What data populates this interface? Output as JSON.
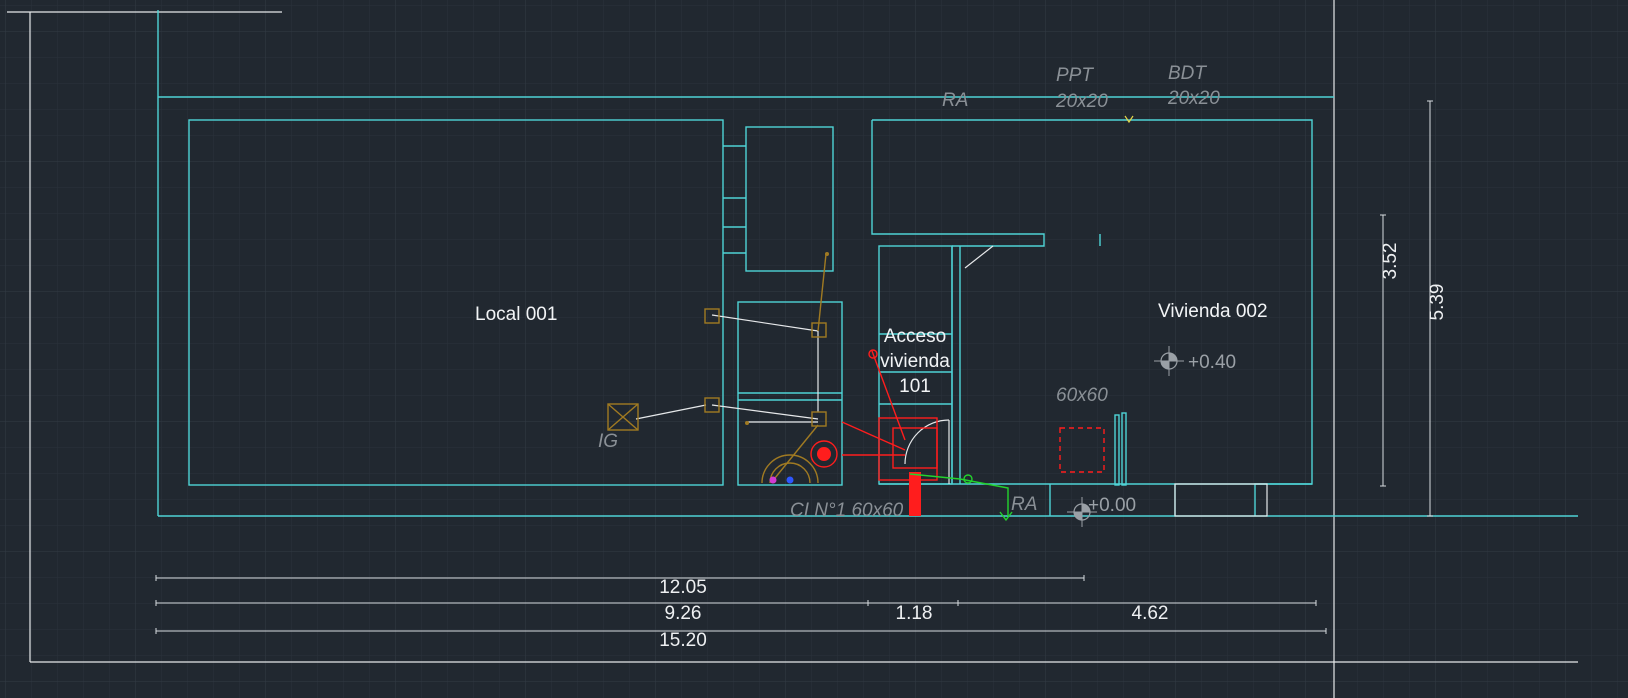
{
  "drawing": {
    "rooms": {
      "local": "Local 001",
      "vivienda": "Vivienda 002",
      "acceso_l1": "Acceso",
      "acceso_l2": "vivienda",
      "acceso_l3": "101"
    },
    "annotations": {
      "ra_top": "RA",
      "ppt": "PPT",
      "ppt_size": "20x20",
      "bdt": "BDT",
      "bdt_size": "20x20",
      "ig": "IG",
      "level_upper": "+0.40",
      "level_lower": "+0.00",
      "box_60": "60x60",
      "cl": "CI N°1 60x60",
      "ra_bottom": "RA"
    },
    "dimensions": {
      "d_352": "3.52",
      "d_539": "5.39",
      "d_1205": "12.05",
      "d_926": "9.26",
      "d_118": "1.18",
      "d_462": "4.62",
      "d_1520": "15.20"
    }
  },
  "colors": {
    "background": "#212830",
    "walls": "#4fd3d6",
    "text": "#f2f4f6",
    "electrical": "#a07a22",
    "red": "#ff1d1d",
    "green": "#23d32d"
  }
}
